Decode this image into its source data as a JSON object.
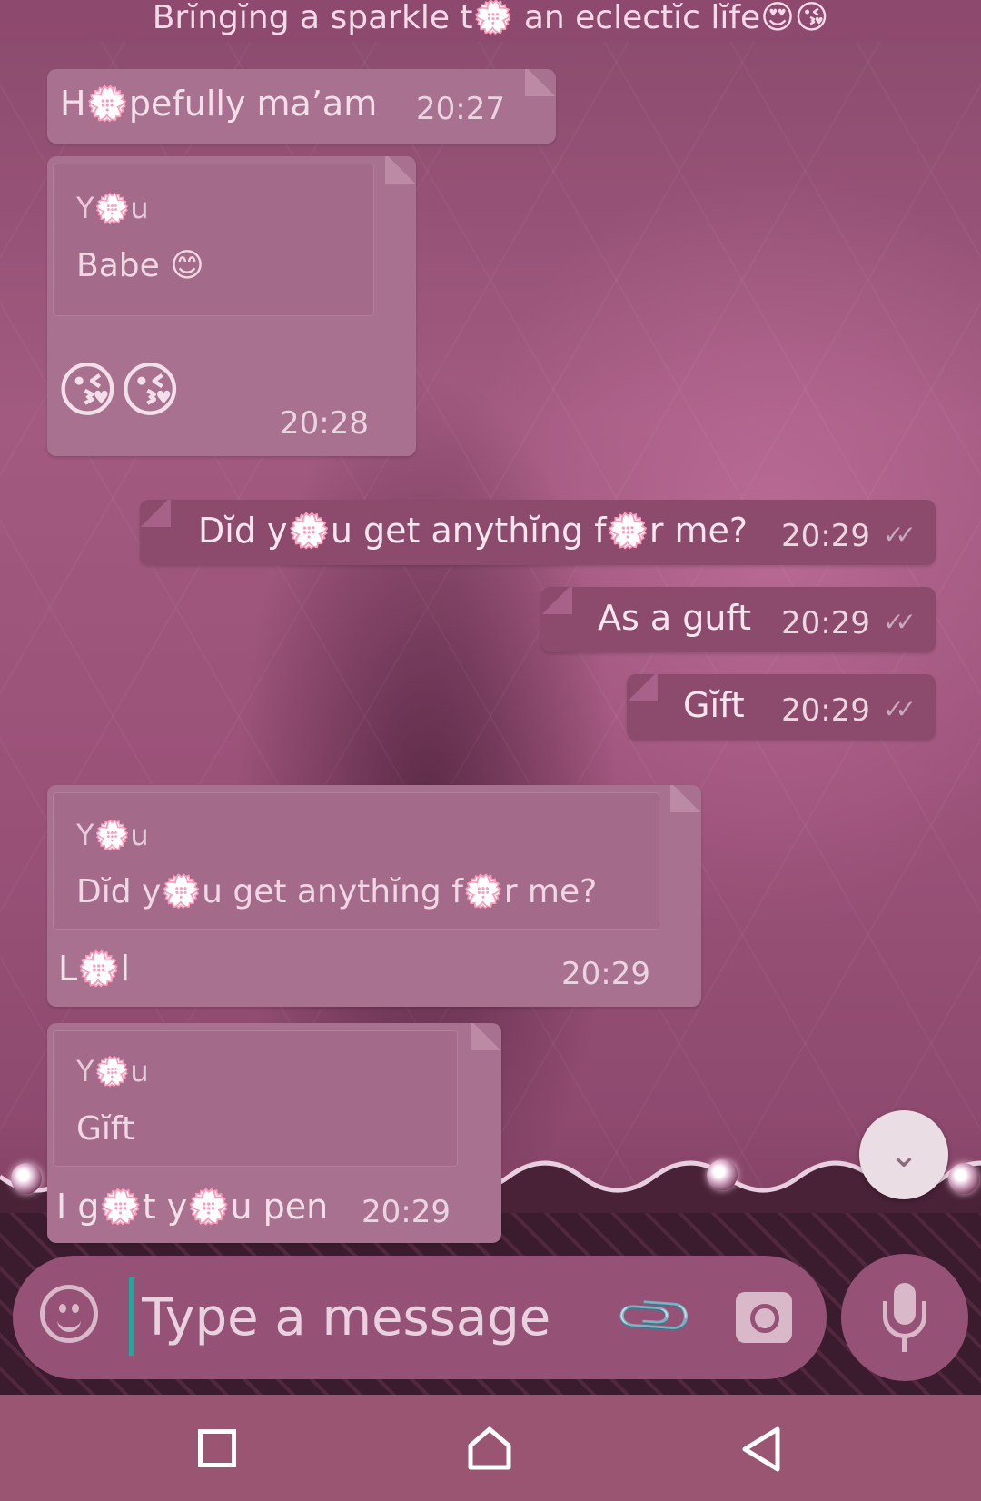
{
  "header": {
    "status_text": "Brĭngĭng a sparkle t💮 an eclectĭc lĭfe😍😘"
  },
  "messages": [
    {
      "direction": "in",
      "text": "H💮pefully ma’am",
      "time": "20:27"
    },
    {
      "direction": "in",
      "quote_author": "Y💮u",
      "quote_text": "Babe 😊",
      "text": "😘😘",
      "time": "20:28"
    },
    {
      "direction": "out",
      "text": "Dĭd y💮u get anythĭng f💮r me?",
      "time": "20:29",
      "ticks": "✓✓"
    },
    {
      "direction": "out",
      "text": "As a guft",
      "time": "20:29",
      "ticks": "✓✓"
    },
    {
      "direction": "out",
      "text": "Gĭft",
      "time": "20:29",
      "ticks": "✓✓"
    },
    {
      "direction": "in",
      "quote_author": "Y💮u",
      "quote_text": "Dĭd y💮u get anythĭng f💮r me?",
      "text": "L💮l",
      "time": "20:29"
    },
    {
      "direction": "in",
      "quote_author": "Y💮u",
      "quote_text": "Gĭft",
      "text": "I g💮t y💮u pen",
      "time": "20:29"
    }
  ],
  "composer": {
    "placeholder": "Type a message"
  },
  "icons": {
    "emoji": "smiley-icon",
    "attach": "paperclip-icon",
    "camera": "camera-icon",
    "mic": "microphone-icon",
    "scroll": "double-chevron-down-icon"
  },
  "colors": {
    "accent_cursor": "#27a59a",
    "bubble_in": "#a97190",
    "bubble_out": "#8c4a6c",
    "navbar": "#9a5573"
  }
}
